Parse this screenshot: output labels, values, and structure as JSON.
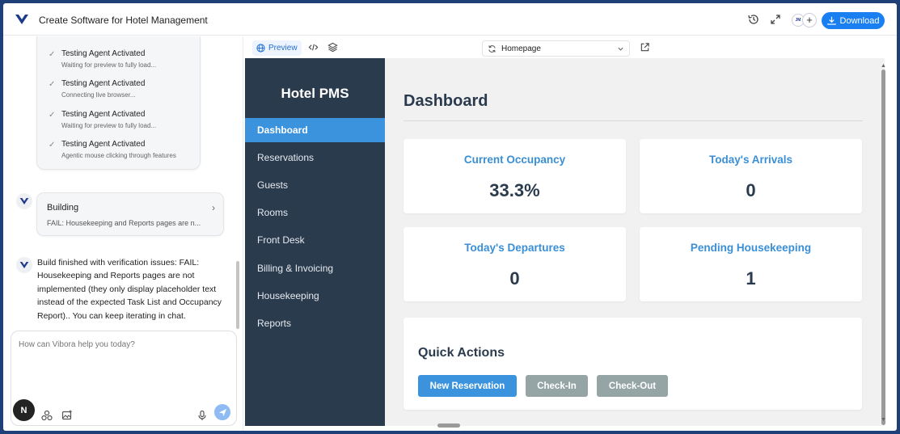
{
  "app": {
    "title": "Create Software for Hotel Management",
    "download_label": "Download",
    "avatar_initials": "JM",
    "add_label": "+"
  },
  "chat": {
    "logs": [
      {
        "title": "Testing Agent Activated",
        "sub": "Waiting for preview to fully load..."
      },
      {
        "title": "Testing Agent Activated",
        "sub": "Connecting live browser..."
      },
      {
        "title": "Testing Agent Activated",
        "sub": "Waiting for preview to fully load..."
      },
      {
        "title": "Testing Agent Activated",
        "sub": "Agentic mouse clicking through features"
      }
    ],
    "building": {
      "title": "Building",
      "sub": "FAIL: Housekeeping and Reports pages are n..."
    },
    "message": "Build finished with verification issues: FAIL: Housekeeping and Reports pages are not implemented (they only display placeholder text instead of the expected Task List and Occupancy Report).. You can keep iterating in chat.",
    "input_placeholder": "How can Vibora help you today?",
    "user_initial": "N"
  },
  "preview_toolbar": {
    "preview_label": "Preview",
    "page": "Homepage"
  },
  "hotel": {
    "brand": "Hotel PMS",
    "nav": [
      "Dashboard",
      "Reservations",
      "Guests",
      "Rooms",
      "Front Desk",
      "Billing & Invoicing",
      "Housekeeping",
      "Reports"
    ],
    "active_nav": "Dashboard",
    "page_title": "Dashboard",
    "stats": [
      {
        "label": "Current Occupancy",
        "value": "33.3%"
      },
      {
        "label": "Today's Arrivals",
        "value": "0"
      },
      {
        "label": "Today's Departures",
        "value": "0"
      },
      {
        "label": "Pending Housekeeping",
        "value": "1"
      }
    ],
    "quick_actions": {
      "title": "Quick Actions",
      "buttons": [
        "New Reservation",
        "Check-In",
        "Check-Out"
      ]
    }
  },
  "colors": {
    "accent": "#1a7ff0",
    "sidebar": "#2b3b4e",
    "stat_label": "#3a8fd6",
    "primary_action": "#3a93dc",
    "secondary_action": "#95a5a6"
  }
}
